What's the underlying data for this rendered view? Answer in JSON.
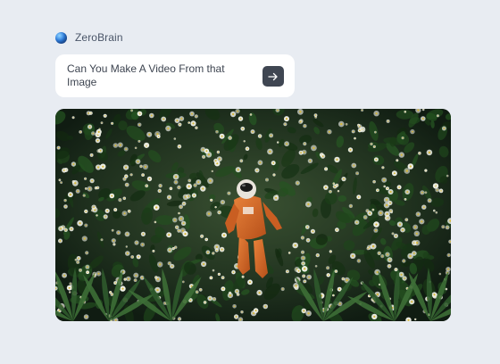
{
  "brand": {
    "name": "ZeroBrain",
    "logo_icon": "gradient-sphere-logo"
  },
  "prompt": {
    "text": "Can You Make A Video From that Image",
    "send_icon": "arrow-right-icon"
  },
  "media": {
    "subject": "astronaut-in-daisy-field-image"
  },
  "colors": {
    "background": "#e8ecf2",
    "card": "#ffffff",
    "send_button": "#3f4652",
    "text": "#3d4450",
    "suit": "#d8641f"
  }
}
